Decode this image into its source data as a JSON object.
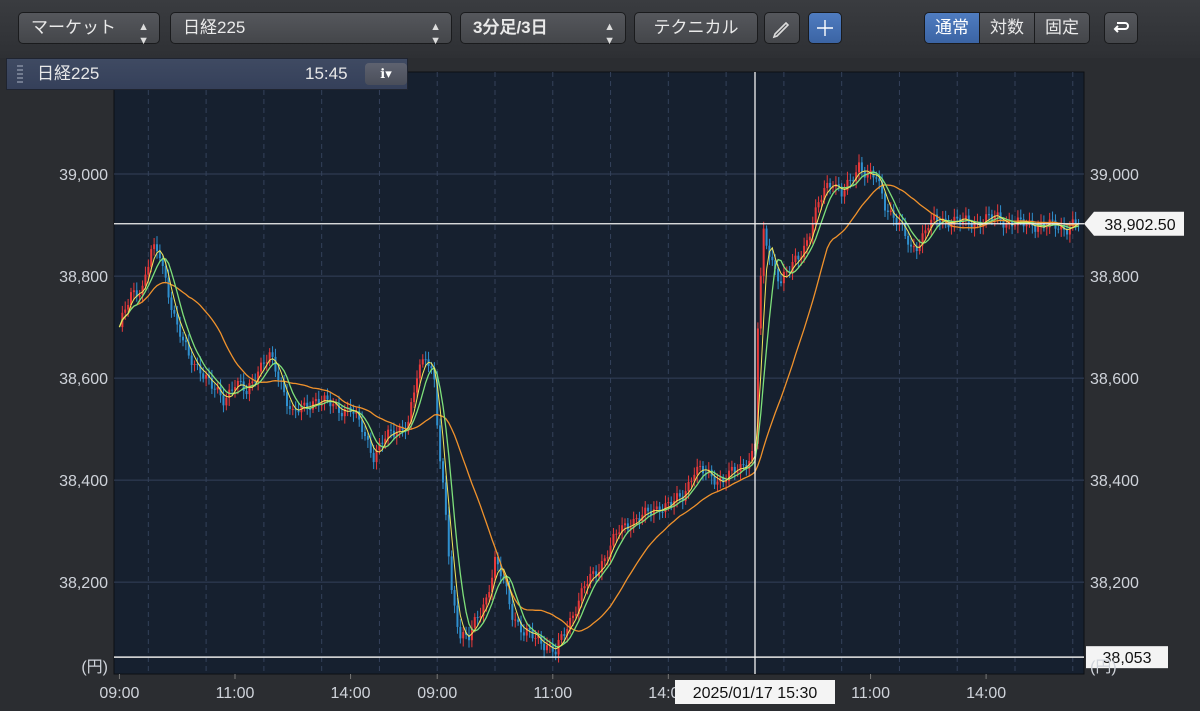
{
  "toolbar": {
    "market_select": "マーケット",
    "symbol_select": "日経225",
    "period_select": "3分足/3日",
    "technical_button": "テクニカル",
    "scale_modes": [
      "通常",
      "対数",
      "固定"
    ],
    "active_scale_mode": "通常"
  },
  "info_panel": {
    "symbol": "日経225",
    "time": "15:45"
  },
  "colors": {
    "background": "#16202f",
    "grid": "#34415a",
    "up_candle": "#e8393a",
    "down_candle": "#2f8fce",
    "ma_short": "#f2e85c",
    "ma_mid": "#7ee07a",
    "ma_long": "#f0922c"
  },
  "chart_data": {
    "type": "line",
    "title": "",
    "y_unit_label": "(円)",
    "ylim": [
      38020,
      39200
    ],
    "yticks": [
      38200,
      38400,
      38600,
      38800,
      39000
    ],
    "ytick_labels": [
      "38,200",
      "38,400",
      "38,600",
      "38,800",
      "39,000"
    ],
    "x_tick_labels": [
      "09:00",
      "11:00",
      "14:00",
      "09:00",
      "11:00",
      "14:00",
      "11:00",
      "14:00"
    ],
    "x_tick_index": [
      0,
      40,
      80,
      110,
      150,
      190,
      260,
      300
    ],
    "n_bars": 333,
    "crosshair": {
      "date_label": "2025/01/17 15:30",
      "index": 220,
      "price": 38902.5,
      "price_label": "38,902.50"
    },
    "min_line": {
      "price": 38053,
      "label": "38,053"
    },
    "price_path": [
      [
        0,
        38700
      ],
      [
        4,
        38760
      ],
      [
        8,
        38780
      ],
      [
        11,
        38850
      ],
      [
        14,
        38840
      ],
      [
        17,
        38770
      ],
      [
        20,
        38700
      ],
      [
        24,
        38640
      ],
      [
        28,
        38620
      ],
      [
        32,
        38580
      ],
      [
        36,
        38560
      ],
      [
        40,
        38590
      ],
      [
        44,
        38570
      ],
      [
        48,
        38620
      ],
      [
        52,
        38640
      ],
      [
        56,
        38590
      ],
      [
        60,
        38530
      ],
      [
        64,
        38540
      ],
      [
        68,
        38560
      ],
      [
        72,
        38550
      ],
      [
        76,
        38540
      ],
      [
        80,
        38540
      ],
      [
        84,
        38500
      ],
      [
        88,
        38450
      ],
      [
        92,
        38480
      ],
      [
        96,
        38500
      ],
      [
        100,
        38510
      ],
      [
        103,
        38600
      ],
      [
        106,
        38650
      ],
      [
        109,
        38600
      ],
      [
        111,
        38430
      ],
      [
        113,
        38330
      ],
      [
        115,
        38180
      ],
      [
        118,
        38100
      ],
      [
        121,
        38090
      ],
      [
        124,
        38130
      ],
      [
        127,
        38170
      ],
      [
        130,
        38240
      ],
      [
        133,
        38200
      ],
      [
        136,
        38140
      ],
      [
        140,
        38100
      ],
      [
        144,
        38090
      ],
      [
        148,
        38080
      ],
      [
        151,
        38060
      ],
      [
        154,
        38100
      ],
      [
        157,
        38140
      ],
      [
        161,
        38190
      ],
      [
        165,
        38220
      ],
      [
        169,
        38260
      ],
      [
        173,
        38300
      ],
      [
        177,
        38320
      ],
      [
        182,
        38330
      ],
      [
        187,
        38350
      ],
      [
        191,
        38350
      ],
      [
        195,
        38370
      ],
      [
        199,
        38420
      ],
      [
        204,
        38410
      ],
      [
        209,
        38400
      ],
      [
        214,
        38420
      ],
      [
        219,
        38450
      ],
      [
        220,
        38470
      ],
      [
        221,
        38700
      ],
      [
        223,
        38880
      ],
      [
        226,
        38830
      ],
      [
        229,
        38790
      ],
      [
        232,
        38810
      ],
      [
        235,
        38840
      ],
      [
        238,
        38870
      ],
      [
        241,
        38920
      ],
      [
        244,
        38970
      ],
      [
        247,
        38990
      ],
      [
        250,
        38960
      ],
      [
        253,
        38980
      ],
      [
        256,
        39020
      ],
      [
        259,
        39000
      ],
      [
        262,
        38990
      ],
      [
        265,
        38940
      ],
      [
        268,
        38920
      ],
      [
        271,
        38890
      ],
      [
        274,
        38850
      ],
      [
        277,
        38870
      ],
      [
        280,
        38900
      ],
      [
        284,
        38910
      ],
      [
        288,
        38910
      ],
      [
        292,
        38905
      ],
      [
        296,
        38905
      ],
      [
        300,
        38910
      ],
      [
        304,
        38915
      ],
      [
        308,
        38905
      ],
      [
        312,
        38900
      ],
      [
        316,
        38905
      ],
      [
        320,
        38895
      ],
      [
        324,
        38900
      ],
      [
        328,
        38895
      ],
      [
        332,
        38902.5
      ]
    ]
  }
}
